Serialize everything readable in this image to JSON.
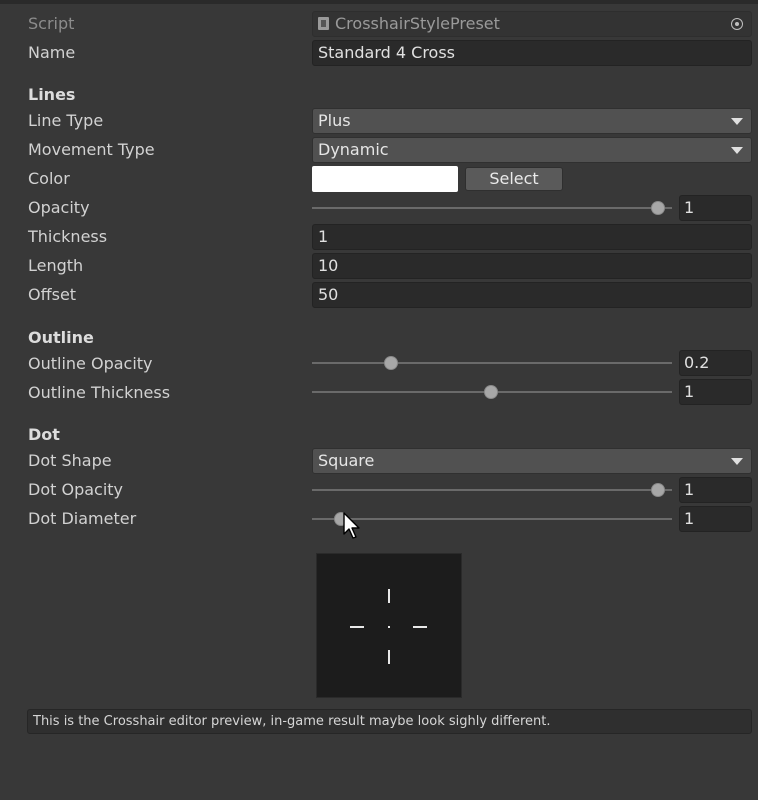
{
  "script": {
    "label": "Script",
    "value": "CrosshairStylePreset"
  },
  "name": {
    "label": "Name",
    "value": "Standard 4 Cross"
  },
  "lines": {
    "header": "Lines",
    "line_type": {
      "label": "Line Type",
      "value": "Plus"
    },
    "movement_type": {
      "label": "Movement Type",
      "value": "Dynamic"
    },
    "color": {
      "label": "Color",
      "value": "#ffffff",
      "select_label": "Select"
    },
    "opacity": {
      "label": "Opacity",
      "value": "1",
      "fraction": 1.0
    },
    "thickness": {
      "label": "Thickness",
      "value": "1"
    },
    "length": {
      "label": "Length",
      "value": "10"
    },
    "offset": {
      "label": "Offset",
      "value": "50"
    }
  },
  "outline": {
    "header": "Outline",
    "opacity": {
      "label": "Outline Opacity",
      "value": "0.2",
      "fraction": 0.2
    },
    "thickness": {
      "label": "Outline Thickness",
      "value": "1",
      "fraction": 0.5
    }
  },
  "dot": {
    "header": "Dot",
    "shape": {
      "label": "Dot Shape",
      "value": "Square"
    },
    "opacity": {
      "label": "Dot Opacity",
      "value": "1",
      "fraction": 1.0
    },
    "diameter": {
      "label": "Dot Diameter",
      "value": "1",
      "fraction": 0.05
    }
  },
  "help_text": "This is the Crosshair editor preview, in-game result maybe look sighly different.",
  "icons": {
    "script_object": "script-file-icon",
    "object_picker": "object-picker-icon",
    "dropdown": "chevron-down-icon",
    "cursor": "mouse-cursor-icon"
  }
}
